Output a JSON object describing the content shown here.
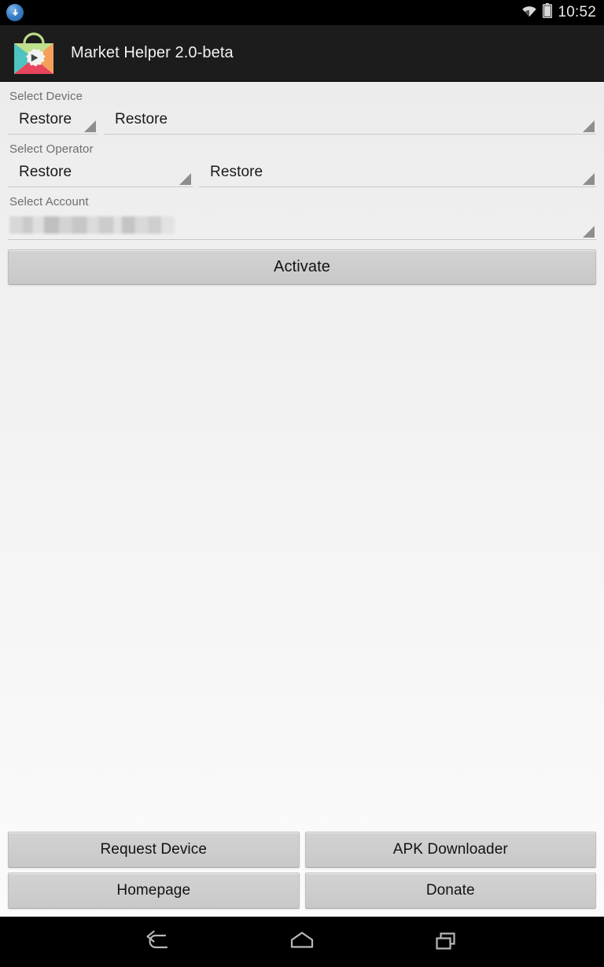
{
  "statusbar": {
    "download_icon": "download-arrow-icon",
    "wifi_icon": "wifi-icon",
    "battery_icon": "battery-icon",
    "clock": "10:52"
  },
  "actionbar": {
    "app_icon": "play-store-gear-icon",
    "title": "Market Helper 2.0-beta"
  },
  "form": {
    "device": {
      "label": "Select Device",
      "brand_value": "Restore",
      "model_value": "Restore"
    },
    "operator": {
      "label": "Select Operator",
      "country_value": "Restore",
      "carrier_value": "Restore"
    },
    "account": {
      "label": "Select Account",
      "value": ""
    },
    "activate_label": "Activate"
  },
  "bottom_buttons": [
    {
      "label": "Request Device",
      "name": "request-device-button"
    },
    {
      "label": "APK Downloader",
      "name": "apk-downloader-button"
    },
    {
      "label": "Homepage",
      "name": "homepage-button"
    },
    {
      "label": "Donate",
      "name": "donate-button"
    }
  ],
  "navbar": {
    "back": "back-icon",
    "home": "home-icon",
    "recents": "recents-icon"
  },
  "colors": {
    "statusbar_bg": "#000000",
    "actionbar_bg": "#1c1c1c",
    "content_bg_top": "#ececec",
    "content_bg_bottom": "#fbfbfb",
    "button_bg": "#cdcdcd",
    "label_text": "#6d6d6d",
    "value_text": "#1a1a1a",
    "underline": "#c9c9c9",
    "caret": "#8e8e8e"
  }
}
